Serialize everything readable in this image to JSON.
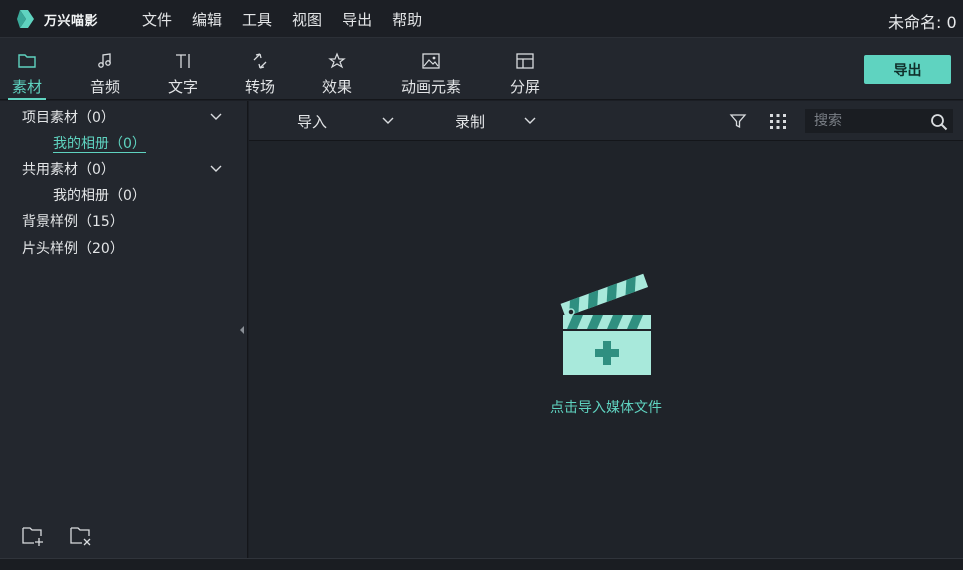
{
  "app": {
    "logo_text": "万兴喵影",
    "project_title": "未命名: 0"
  },
  "menu": [
    "文件",
    "编辑",
    "工具",
    "视图",
    "导出",
    "帮助"
  ],
  "tabs": [
    {
      "label": "素材",
      "icon": "folder-icon",
      "active": true
    },
    {
      "label": "音频",
      "icon": "music-note-icon",
      "active": false
    },
    {
      "label": "文字",
      "icon": "text-icon",
      "active": false
    },
    {
      "label": "转场",
      "icon": "transition-icon",
      "active": false
    },
    {
      "label": "效果",
      "icon": "effects-icon",
      "active": false
    },
    {
      "label": "动画元素",
      "icon": "image-icon",
      "active": false
    },
    {
      "label": "分屏",
      "icon": "split-screen-icon",
      "active": false
    }
  ],
  "export_button": "导出",
  "left_panel": {
    "items": [
      {
        "label": "项目素材（0）",
        "expandable": true
      },
      {
        "label": "我的相册（0）",
        "child": true,
        "selected": true
      },
      {
        "label": "共用素材（0）",
        "expandable": true
      },
      {
        "label": "我的相册（0）",
        "child": true
      },
      {
        "label": "背景样例（15）"
      },
      {
        "label": "片头样例（20）"
      }
    ]
  },
  "toolbar": {
    "import_label": "导入",
    "record_label": "录制",
    "search_placeholder": "搜索"
  },
  "drop_zone": {
    "text": "点击导入媒体文件"
  },
  "colors": {
    "accent": "#5fd3c0",
    "background": "#1f2329",
    "panel": "#23272e"
  }
}
